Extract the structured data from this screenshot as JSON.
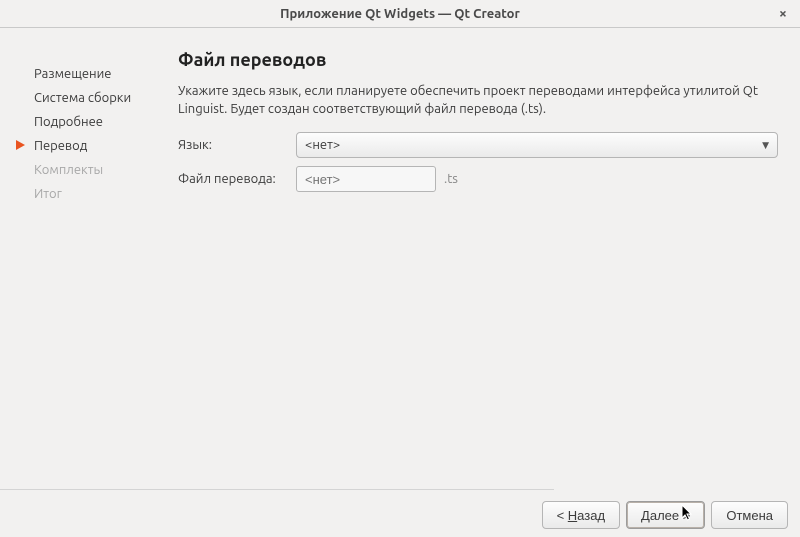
{
  "window": {
    "title": "Приложение Qt Widgets — Qt Creator"
  },
  "steps": [
    {
      "label": "Размещение",
      "state": "done"
    },
    {
      "label": "Система сборки",
      "state": "done"
    },
    {
      "label": "Подробнее",
      "state": "done"
    },
    {
      "label": "Перевод",
      "state": "active"
    },
    {
      "label": "Комплекты",
      "state": "disabled"
    },
    {
      "label": "Итог",
      "state": "disabled"
    }
  ],
  "content": {
    "heading": "Файл переводов",
    "description": "Укажите здесь язык, если планируете обеспечить проект переводами интерфейса утилитой Qt Linguist. Будет создан соответствующий файл перевода (.ts).",
    "language_label": "Язык:",
    "language_value": "<нет>",
    "file_label": "Файл перевода:",
    "file_placeholder": "<нет>",
    "file_suffix": ".ts"
  },
  "buttons": {
    "back_prefix": "< ",
    "back_mnemonic": "Н",
    "back_rest": "азад",
    "next_mnemonic": "Д",
    "next_rest": "алее >",
    "cancel": "Отмена"
  }
}
